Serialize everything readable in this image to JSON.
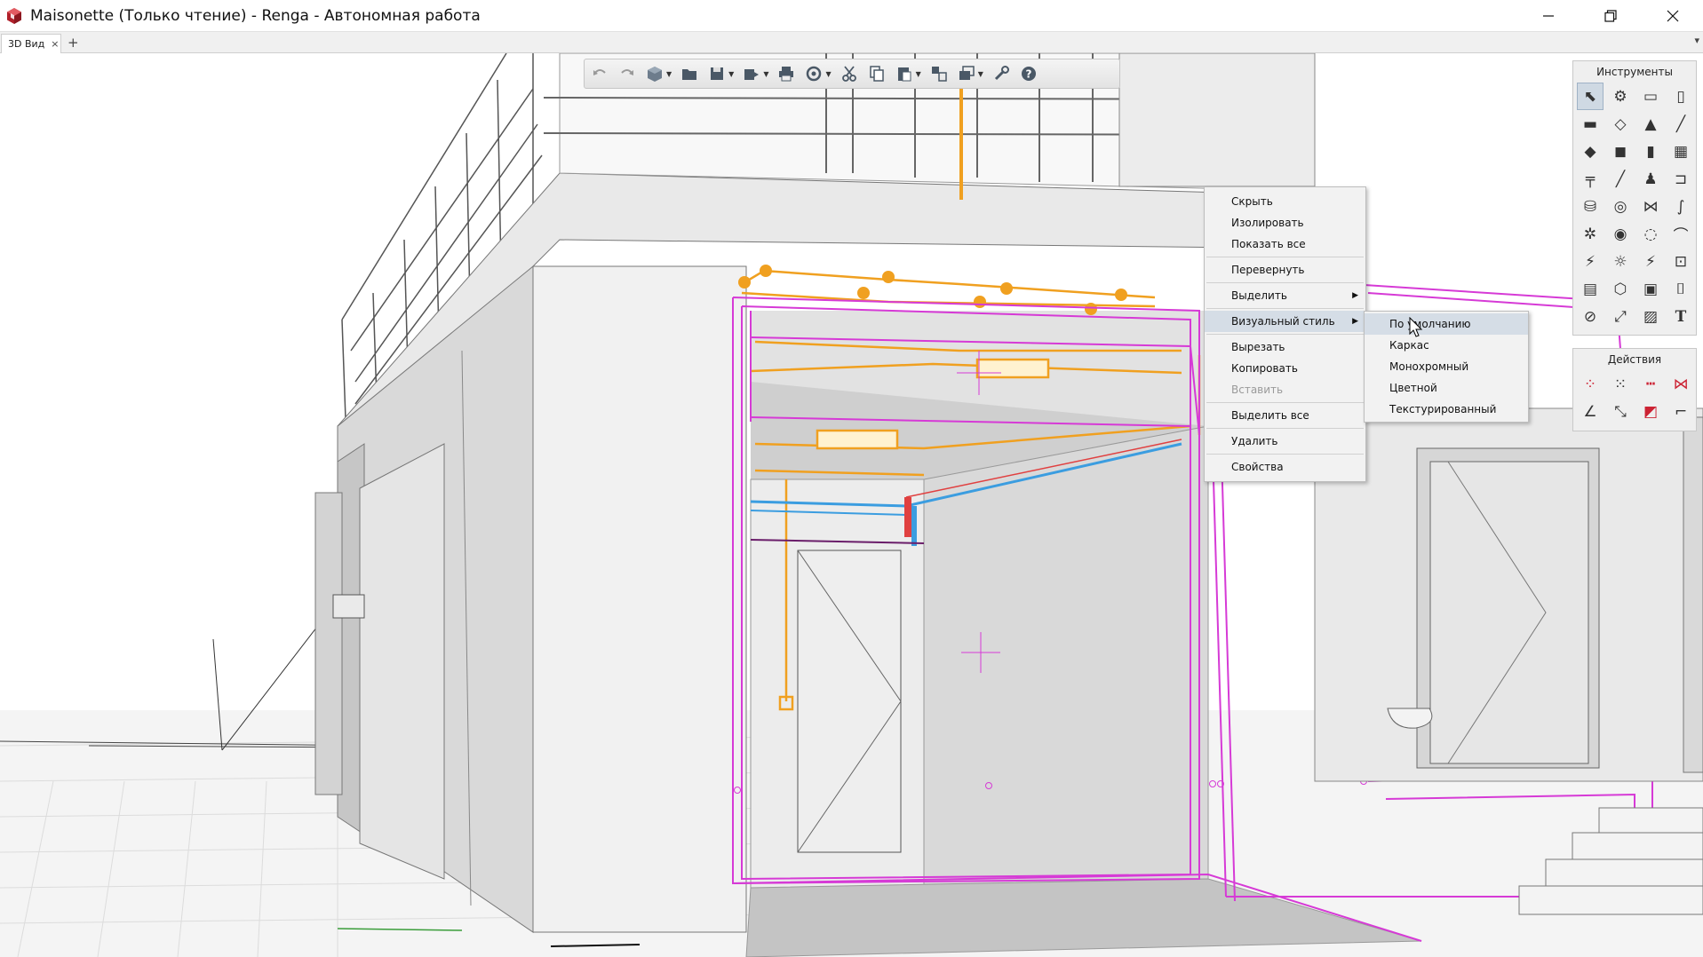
{
  "window": {
    "title": "Maisonette (Только чтение) - Renga - Автономная работа",
    "minimize_icon": "minimize-icon",
    "maximize_icon": "restore-icon",
    "close_icon": "close-icon"
  },
  "tabs": {
    "items": [
      {
        "label": "3D Вид",
        "close": "×"
      }
    ],
    "add": "+",
    "scroll": "▾"
  },
  "toolbar": {
    "icons": [
      "undo-icon",
      "redo-icon",
      "cube-icon",
      "open-folder-icon",
      "save-icon",
      "export-icon",
      "print-icon",
      "sync-icon",
      "cut-icon",
      "copy-icon",
      "paste-icon",
      "view-switch-icon",
      "layers-icon",
      "settings-wrench-icon",
      "help-icon"
    ]
  },
  "tools_panel": {
    "title": "Инструменты",
    "text_tool": "T"
  },
  "actions_panel": {
    "title": "Действия"
  },
  "context_menu": {
    "items": [
      {
        "label": "Скрыть"
      },
      {
        "label": "Изолировать"
      },
      {
        "label": "Показать все"
      },
      {
        "label": "Перевернуть"
      },
      {
        "label": "Выделить"
      },
      {
        "label": "Визуальный стиль"
      },
      {
        "label": "Вырезать"
      },
      {
        "label": "Копировать"
      },
      {
        "label": "Вставить",
        "disabled": true
      },
      {
        "label": "Выделить все"
      },
      {
        "label": "Удалить"
      },
      {
        "label": "Свойства"
      }
    ],
    "submenu_arrow": "▶"
  },
  "visual_style_submenu": {
    "items": [
      {
        "label": "По умолчанию",
        "highlighted": true
      },
      {
        "label": "Каркас"
      },
      {
        "label": "Монохромный"
      },
      {
        "label": "Цветной"
      },
      {
        "label": "Текстурированный"
      }
    ]
  },
  "colors": {
    "accent_magenta": "#d63ad6",
    "engineering_orange": "#f0a020",
    "pipe_blue": "#3b9de0",
    "pipe_red": "#e04040",
    "menu_highlight": "#d5dde6"
  }
}
